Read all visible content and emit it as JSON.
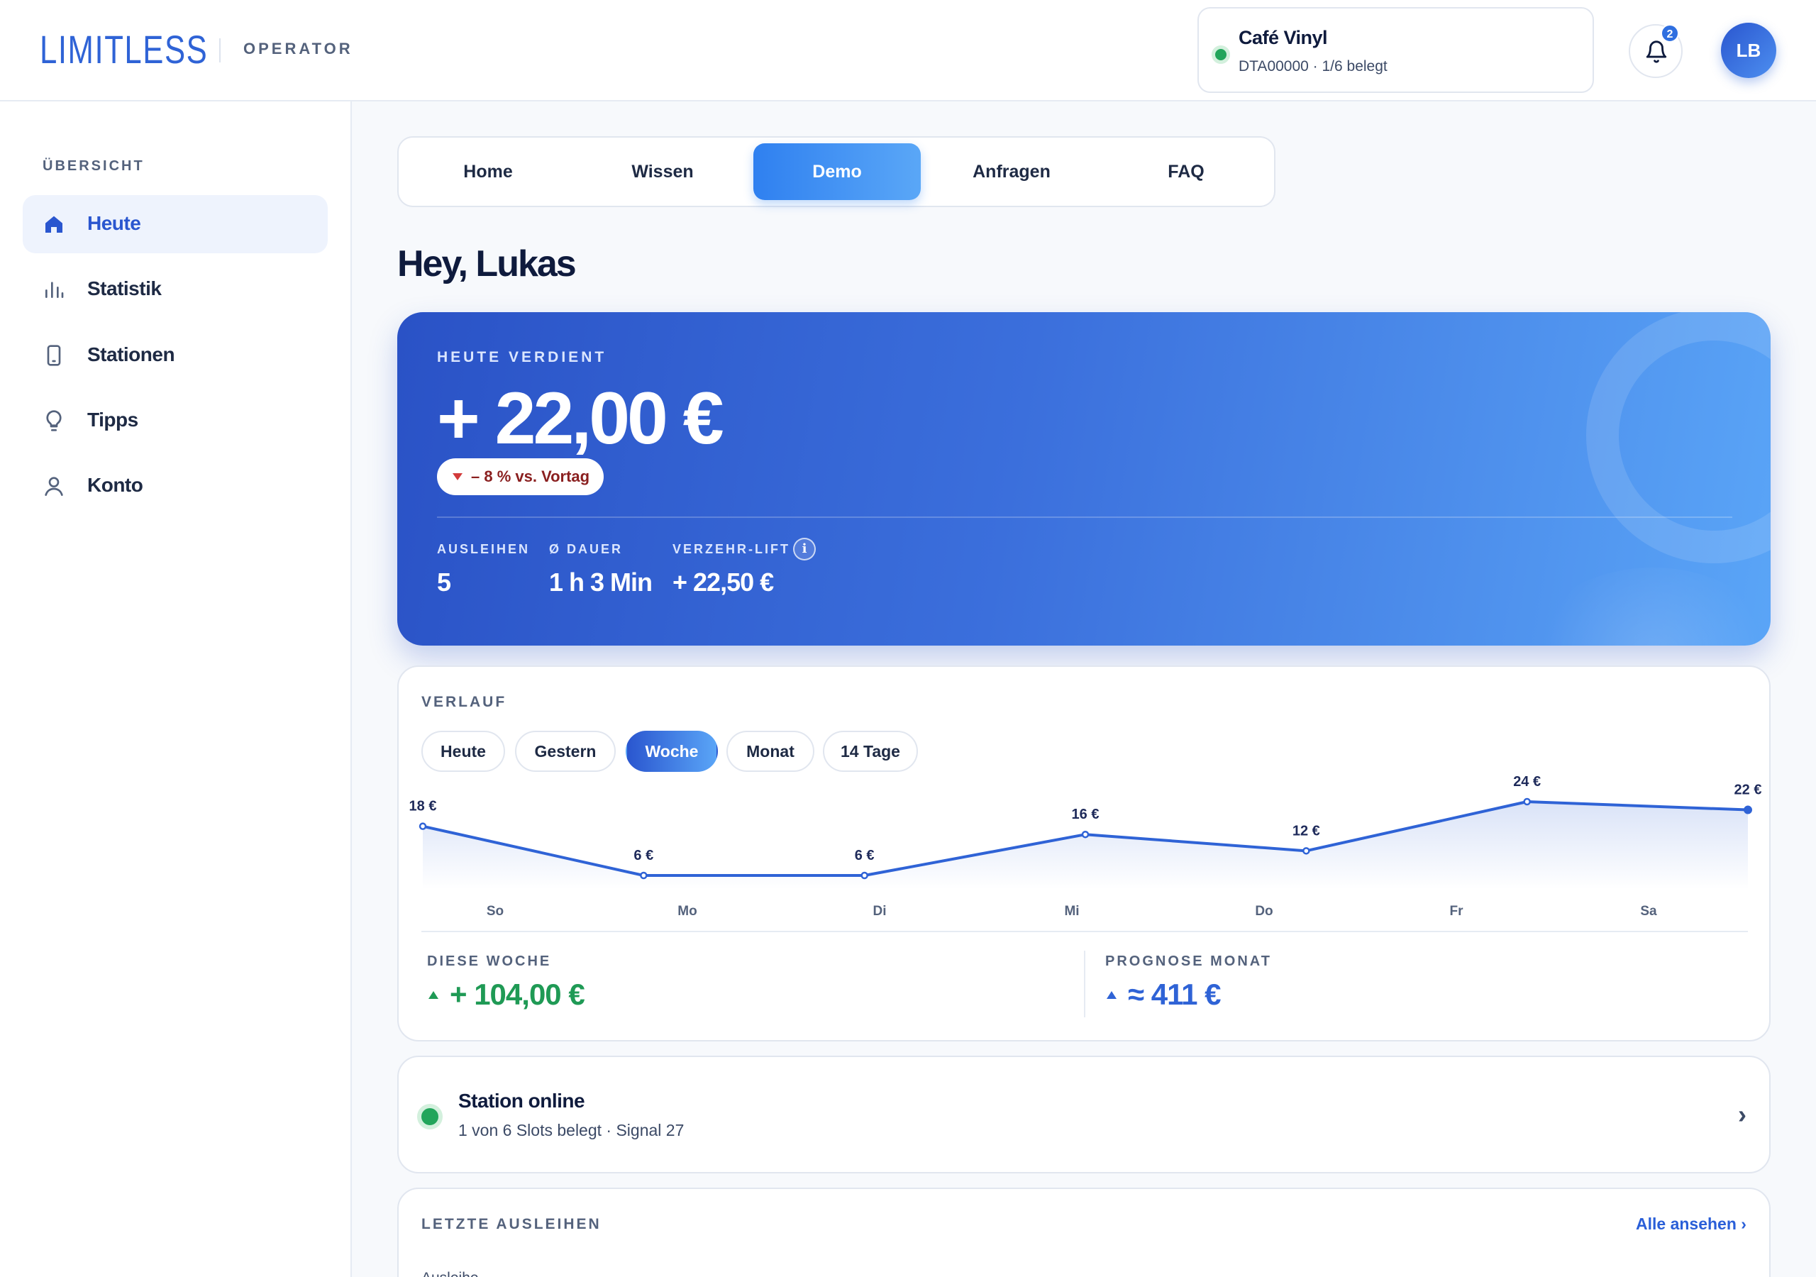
{
  "header": {
    "logo": "LIMITLESS",
    "role": "OPERATOR",
    "venue": {
      "name": "Café Vinyl",
      "details": "DTA00000 · 1/6 belegt",
      "status_color": "#22a55b"
    },
    "notifications_count": "2",
    "avatar_initials": "LB"
  },
  "sidebar": {
    "heading": "ÜBERSICHT",
    "items": [
      {
        "label": "Heute",
        "icon": "home-icon",
        "active": true
      },
      {
        "label": "Statistik",
        "icon": "bar-chart-icon",
        "active": false
      },
      {
        "label": "Stationen",
        "icon": "phone-icon",
        "active": false
      },
      {
        "label": "Tipps",
        "icon": "lightbulb-icon",
        "active": false
      },
      {
        "label": "Konto",
        "icon": "user-icon",
        "active": false
      }
    ]
  },
  "tabs": [
    {
      "label": "Home",
      "active": false
    },
    {
      "label": "Wissen",
      "active": false
    },
    {
      "label": "Demo",
      "active": true
    },
    {
      "label": "Anfragen",
      "active": false
    },
    {
      "label": "FAQ",
      "active": false
    }
  ],
  "greeting": "Hey, Lukas",
  "hero": {
    "label": "HEUTE VERDIENT",
    "amount": "+ 22,00 €",
    "delta": "– 8 % vs. Vortag",
    "stats": [
      {
        "label": "AUSLEIHEN",
        "value": "5"
      },
      {
        "label": "Ø DAUER",
        "value": "1 h 3 Min"
      },
      {
        "label": "VERZEHR-LIFT",
        "value": "+ 22,50 €"
      }
    ],
    "info_icon_glyph": "i"
  },
  "verlauf": {
    "title": "VERLAUF",
    "ranges": [
      {
        "label": "Heute",
        "active": false
      },
      {
        "label": "Gestern",
        "active": false
      },
      {
        "label": "Woche",
        "active": true
      },
      {
        "label": "Monat",
        "active": false
      },
      {
        "label": "14 Tage",
        "active": false
      }
    ],
    "summary": {
      "week_label": "DIESE WOCHE",
      "week_value": "+ 104,00 €",
      "forecast_label": "PROGNOSE MONAT",
      "forecast_value": "≈ 411 €"
    },
    "colors": {
      "line": "#2f63d6",
      "positive": "#1f9a55",
      "forecast": "#2f63d6"
    }
  },
  "chart_data": {
    "type": "line",
    "categories": [
      "So",
      "Mo",
      "Di",
      "Mi",
      "Do",
      "Fr",
      "Sa"
    ],
    "series": [
      {
        "values": [
          18,
          6,
          6,
          16,
          12,
          24,
          22
        ]
      }
    ],
    "data_labels": [
      "18 €",
      "6 €",
      "6 €",
      "16 €",
      "12 €",
      "24 €",
      "22 €"
    ],
    "title": "",
    "xlabel": "",
    "ylabel": "",
    "ylim": [
      0,
      30
    ],
    "grid": false,
    "legend": "none"
  },
  "station": {
    "title": "Station online",
    "details": "1 von 6 Slots belegt · Signal 27",
    "chevron": "›"
  },
  "recent": {
    "title": "LETZTE AUSLEIHEN",
    "see_all": "Alle ansehen ›",
    "first_row_partial": "Ausleihe"
  }
}
